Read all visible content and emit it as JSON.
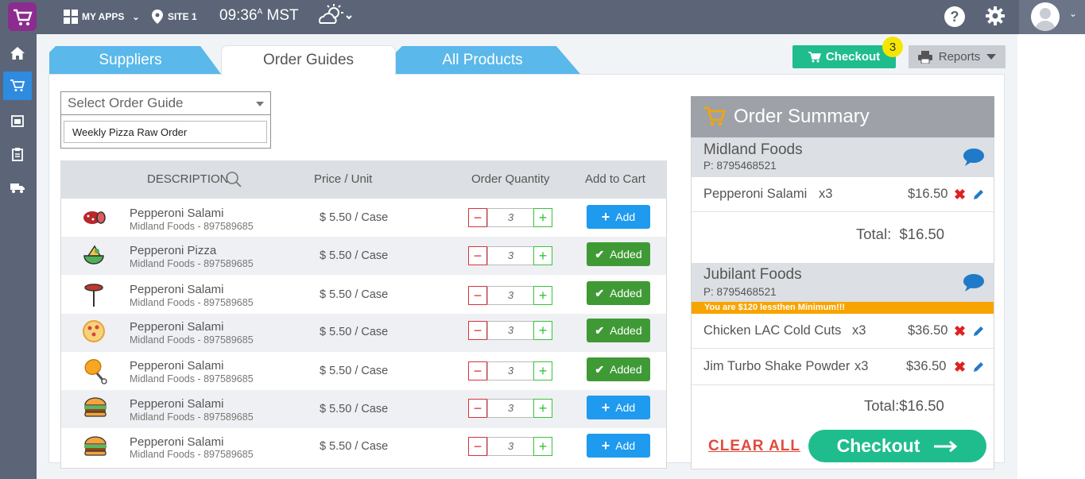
{
  "topbar": {
    "apps_label": "MY APPS",
    "site_label": "SITE 1",
    "time": "09:36",
    "ampm": "A",
    "tz": "MST"
  },
  "tabs": [
    {
      "label": "Suppliers"
    },
    {
      "label": "Order Guides"
    },
    {
      "label": "All Products"
    }
  ],
  "toolbar": {
    "checkout_label": "Checkout",
    "cart_count": "3",
    "reports_label": "Reports"
  },
  "guide": {
    "select_placeholder": "Select Order Guide",
    "option": "Weekly Pizza Raw Order"
  },
  "table": {
    "headers": {
      "description": "DESCRIPTION",
      "price": "Price / Unit",
      "qty": "Order Quantity",
      "cart": "Add to Cart"
    },
    "rows": [
      {
        "name": "Pepperoni Salami",
        "supplier": "Midland Foods - 897589685",
        "price": "$ 5.50 / Case",
        "qty": "3",
        "status": "Add",
        "icon": "salami-icon"
      },
      {
        "name": "Pepperoni Pizza",
        "supplier": "Midland Foods - 897589685",
        "price": "$ 5.50 / Case",
        "qty": "3",
        "status": "Added",
        "icon": "nachos-icon"
      },
      {
        "name": "Pepperoni Salami",
        "supplier": "Midland Foods - 897589685",
        "price": "$ 5.50 / Case",
        "qty": "3",
        "status": "Added",
        "icon": "sausage-fork-icon"
      },
      {
        "name": "Pepperoni Salami",
        "supplier": "Midland Foods - 897589685",
        "price": "$ 5.50 / Case",
        "qty": "3",
        "status": "Added",
        "icon": "pizza-icon"
      },
      {
        "name": "Pepperoni Salami",
        "supplier": "Midland Foods - 897589685",
        "price": "$ 5.50 / Case",
        "qty": "3",
        "status": "Added",
        "icon": "chicken-leg-icon"
      },
      {
        "name": "Pepperoni Salami",
        "supplier": "Midland Foods - 897589685",
        "price": "$ 5.50 / Case",
        "qty": "3",
        "status": "Add",
        "icon": "burger-icon"
      },
      {
        "name": "Pepperoni Salami",
        "supplier": "Midland Foods - 897589685",
        "price": "$ 5.50 / Case",
        "qty": "3",
        "status": "Add",
        "icon": "burger-icon"
      }
    ]
  },
  "summary": {
    "title": "Order Summary",
    "vendors": [
      {
        "name": "Midland Foods",
        "phone": "P: 8795468521",
        "items": [
          {
            "name": "Pepperoni Salami",
            "qty": "x3",
            "price": "$16.50"
          }
        ],
        "total_label": "Total:",
        "total": "$16.50"
      },
      {
        "name": "Jubilant Foods",
        "phone": "P: 8795468521",
        "warning": "You are $120 lessthen Minimum!!!",
        "items": [
          {
            "name": "Chicken LAC Cold Cuts",
            "qty": "x3",
            "price": "$36.50"
          },
          {
            "name": "Jim Turbo Shake Powder",
            "qty": "x3",
            "price": "$36.50"
          }
        ],
        "total_label": "Total:",
        "total": "$16.50"
      }
    ],
    "clear_all": "CLEAR ALL",
    "checkout": "Checkout"
  },
  "colors": {
    "topbar": "#5b6577",
    "tab_blue": "#5ab8ea",
    "checkout_green": "#1fbd8e",
    "add_blue": "#1e9aee",
    "added_green": "#3f9a35",
    "warning_orange": "#f8a400"
  }
}
